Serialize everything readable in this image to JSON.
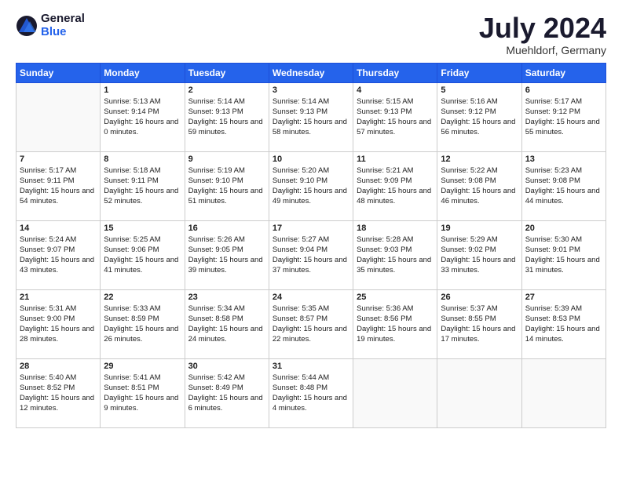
{
  "header": {
    "logo_general": "General",
    "logo_blue": "Blue",
    "month_year": "July 2024",
    "location": "Muehldorf, Germany"
  },
  "columns": [
    "Sunday",
    "Monday",
    "Tuesday",
    "Wednesday",
    "Thursday",
    "Friday",
    "Saturday"
  ],
  "weeks": [
    [
      {
        "day": "",
        "empty": true
      },
      {
        "day": "1",
        "rise": "5:13 AM",
        "set": "9:14 PM",
        "daylight": "16 hours and 0 minutes."
      },
      {
        "day": "2",
        "rise": "5:14 AM",
        "set": "9:13 PM",
        "daylight": "15 hours and 59 minutes."
      },
      {
        "day": "3",
        "rise": "5:14 AM",
        "set": "9:13 PM",
        "daylight": "15 hours and 58 minutes."
      },
      {
        "day": "4",
        "rise": "5:15 AM",
        "set": "9:13 PM",
        "daylight": "15 hours and 57 minutes."
      },
      {
        "day": "5",
        "rise": "5:16 AM",
        "set": "9:12 PM",
        "daylight": "15 hours and 56 minutes."
      },
      {
        "day": "6",
        "rise": "5:17 AM",
        "set": "9:12 PM",
        "daylight": "15 hours and 55 minutes."
      }
    ],
    [
      {
        "day": "7",
        "rise": "5:17 AM",
        "set": "9:11 PM",
        "daylight": "15 hours and 54 minutes."
      },
      {
        "day": "8",
        "rise": "5:18 AM",
        "set": "9:11 PM",
        "daylight": "15 hours and 52 minutes."
      },
      {
        "day": "9",
        "rise": "5:19 AM",
        "set": "9:10 PM",
        "daylight": "15 hours and 51 minutes."
      },
      {
        "day": "10",
        "rise": "5:20 AM",
        "set": "9:10 PM",
        "daylight": "15 hours and 49 minutes."
      },
      {
        "day": "11",
        "rise": "5:21 AM",
        "set": "9:09 PM",
        "daylight": "15 hours and 48 minutes."
      },
      {
        "day": "12",
        "rise": "5:22 AM",
        "set": "9:08 PM",
        "daylight": "15 hours and 46 minutes."
      },
      {
        "day": "13",
        "rise": "5:23 AM",
        "set": "9:08 PM",
        "daylight": "15 hours and 44 minutes."
      }
    ],
    [
      {
        "day": "14",
        "rise": "5:24 AM",
        "set": "9:07 PM",
        "daylight": "15 hours and 43 minutes."
      },
      {
        "day": "15",
        "rise": "5:25 AM",
        "set": "9:06 PM",
        "daylight": "15 hours and 41 minutes."
      },
      {
        "day": "16",
        "rise": "5:26 AM",
        "set": "9:05 PM",
        "daylight": "15 hours and 39 minutes."
      },
      {
        "day": "17",
        "rise": "5:27 AM",
        "set": "9:04 PM",
        "daylight": "15 hours and 37 minutes."
      },
      {
        "day": "18",
        "rise": "5:28 AM",
        "set": "9:03 PM",
        "daylight": "15 hours and 35 minutes."
      },
      {
        "day": "19",
        "rise": "5:29 AM",
        "set": "9:02 PM",
        "daylight": "15 hours and 33 minutes."
      },
      {
        "day": "20",
        "rise": "5:30 AM",
        "set": "9:01 PM",
        "daylight": "15 hours and 31 minutes."
      }
    ],
    [
      {
        "day": "21",
        "rise": "5:31 AM",
        "set": "9:00 PM",
        "daylight": "15 hours and 28 minutes."
      },
      {
        "day": "22",
        "rise": "5:33 AM",
        "set": "8:59 PM",
        "daylight": "15 hours and 26 minutes."
      },
      {
        "day": "23",
        "rise": "5:34 AM",
        "set": "8:58 PM",
        "daylight": "15 hours and 24 minutes."
      },
      {
        "day": "24",
        "rise": "5:35 AM",
        "set": "8:57 PM",
        "daylight": "15 hours and 22 minutes."
      },
      {
        "day": "25",
        "rise": "5:36 AM",
        "set": "8:56 PM",
        "daylight": "15 hours and 19 minutes."
      },
      {
        "day": "26",
        "rise": "5:37 AM",
        "set": "8:55 PM",
        "daylight": "15 hours and 17 minutes."
      },
      {
        "day": "27",
        "rise": "5:39 AM",
        "set": "8:53 PM",
        "daylight": "15 hours and 14 minutes."
      }
    ],
    [
      {
        "day": "28",
        "rise": "5:40 AM",
        "set": "8:52 PM",
        "daylight": "15 hours and 12 minutes."
      },
      {
        "day": "29",
        "rise": "5:41 AM",
        "set": "8:51 PM",
        "daylight": "15 hours and 9 minutes."
      },
      {
        "day": "30",
        "rise": "5:42 AM",
        "set": "8:49 PM",
        "daylight": "15 hours and 6 minutes."
      },
      {
        "day": "31",
        "rise": "5:44 AM",
        "set": "8:48 PM",
        "daylight": "15 hours and 4 minutes."
      },
      {
        "day": "",
        "empty": true
      },
      {
        "day": "",
        "empty": true
      },
      {
        "day": "",
        "empty": true
      }
    ]
  ]
}
